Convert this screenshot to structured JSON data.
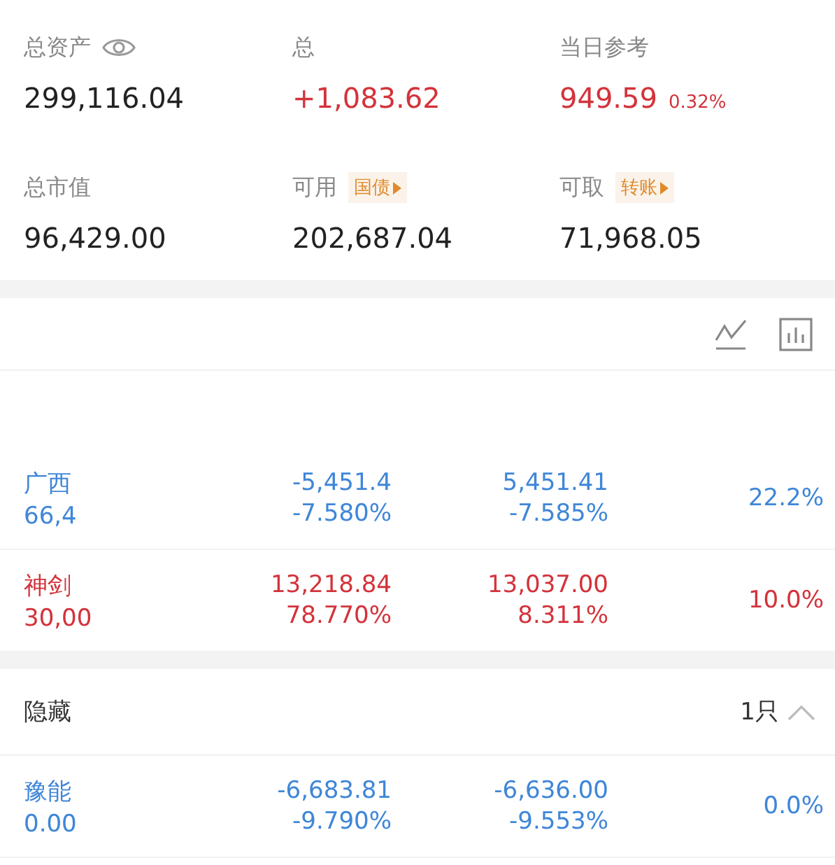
{
  "summary": [
    {
      "label": "总资产",
      "has_eye": true,
      "value": "299,116.04",
      "color": "#222222"
    },
    {
      "label": "总",
      "value": "+1,083.62",
      "color": "#d3333b"
    },
    {
      "label": "当日参考",
      "value": "949.59",
      "sub": "0.32%",
      "color": "#d3333b"
    },
    {
      "label": "总市值",
      "value": "96,429.00",
      "color": "#222222"
    },
    {
      "label": "可用",
      "tag": "国债",
      "value": "202,687.04",
      "color": "#222222"
    },
    {
      "label": "可取",
      "tag": "转账",
      "value": "71,968.05",
      "color": "#222222"
    }
  ],
  "holdings": [
    {
      "color": "#3f86d8",
      "name": "广西",
      "sub": "66,4",
      "pl": "-5,451.4",
      "pl_pct": "-7.580%",
      "day": "5,451.41",
      "day_pct": "-7.585%",
      "share": "22.2%"
    },
    {
      "color": "#d3333b",
      "name": "神剑",
      "sub": "30,00",
      "pl": "13,218.84",
      "pl_pct": "78.770%",
      "day": "13,037.00",
      "day_pct": "8.311%",
      "share": "10.0%"
    }
  ],
  "hidden": {
    "label": "隐藏",
    "count": "1只",
    "expanded": true,
    "rows": [
      {
        "color": "#3f86d8",
        "name": "豫能",
        "sub": "0.00",
        "pl": "-6,683.81",
        "pl_pct": "-9.790%",
        "day": "-6,636.00",
        "day_pct": "-9.553%",
        "share": "0.0%"
      }
    ]
  }
}
